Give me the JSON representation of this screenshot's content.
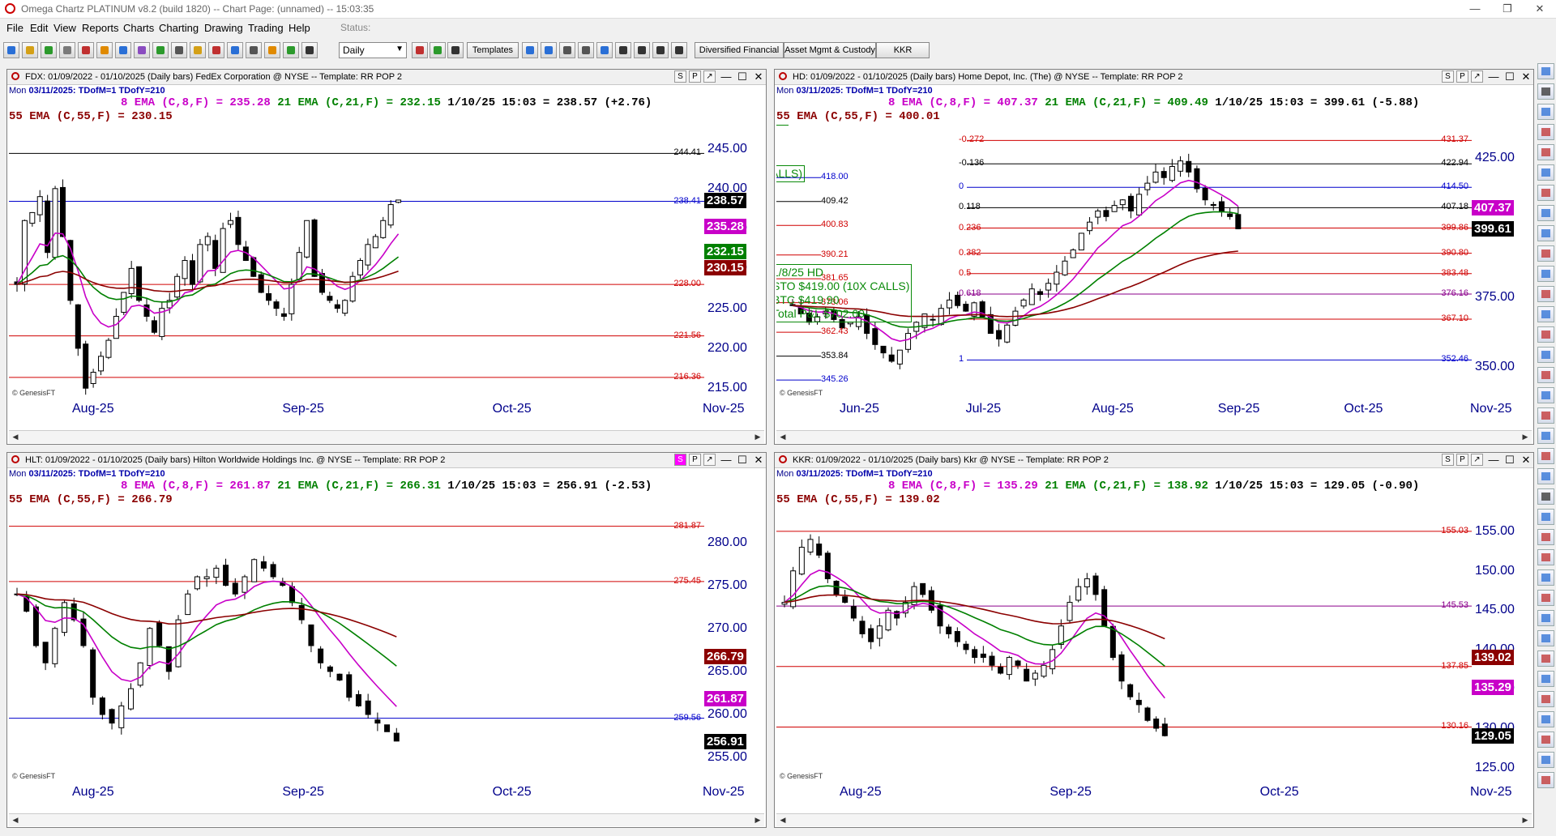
{
  "window": {
    "title": "Omega Chartz PLATINUM v8.2 (build 1820)  --  Chart Page: (unnamed)  --  15:03:35",
    "restore": "❐",
    "close": "✕"
  },
  "menu": [
    "File",
    "Edit",
    "View",
    "Reports",
    "Charts",
    "Charting",
    "Drawing",
    "Trading",
    "Help"
  ],
  "status_label": "Status:",
  "toolbar": {
    "period": "Daily",
    "templates_label": "Templates",
    "list_buttons": [
      "Diversified Financial",
      "Asset Mgmt & Custody",
      "KKR"
    ]
  },
  "colors": {
    "ema8": "#c800c8",
    "ema21": "#008000",
    "ema55": "#8b0000",
    "support": "#d00000",
    "blue_level": "#0000cc"
  },
  "panels": [
    {
      "id": "fdx",
      "title": "FDX: 01/09/2022 - 01/10/2025  (Daily bars)  FedEx Corporation @ NYSE  --  Template: RR POP 2",
      "date_line_day": "Mon",
      "date_line_date": "03/11/2025:",
      "date_line_rest": "TDofM=1  TDofY=210",
      "ema8": "8 EMA (C,8,F) = 235.28",
      "ema21": "21 EMA (C,21,F) = 232.15",
      "last": "1/10/25 15:03 = 238.57 (+2.76)",
      "ema55": "55 EMA (C,55,F) = 230.15",
      "s_active": false,
      "price_ticks": [
        "245.00",
        "240.00",
        "235.00",
        "230.00",
        "225.00",
        "220.00",
        "215.00"
      ],
      "price_boxes": [
        {
          "label": "238.57",
          "bg": "#000000",
          "fg": "#ffffff"
        },
        {
          "label": "235.28",
          "bg": "#c800c8",
          "fg": "#ffffff"
        },
        {
          "label": "232.15",
          "bg": "#008000",
          "fg": "#ffffff"
        },
        {
          "label": "230.15",
          "bg": "#8b0000",
          "fg": "#ffffff"
        }
      ],
      "levels": [
        {
          "label": "244.41",
          "color": "#000000"
        },
        {
          "label": "238.41",
          "color": "#0000cc"
        },
        {
          "label": "228.00",
          "color": "#d00000"
        },
        {
          "label": "221.56",
          "color": "#d00000"
        },
        {
          "label": "216.36",
          "color": "#d00000"
        }
      ],
      "x_ticks": [
        "Aug-25",
        "Sep-25",
        "Oct-25",
        "Nov-25"
      ],
      "watermark": "© GenesisFT",
      "chart_data": {
        "type": "candlestick",
        "price_range": [
          213.5,
          248
        ],
        "closes": [
          228,
          236,
          237,
          239,
          232,
          240,
          234,
          226,
          220,
          215,
          217,
          219,
          221,
          224,
          227,
          230,
          226,
          224,
          222,
          225,
          226,
          229,
          231,
          228,
          233,
          234,
          230,
          235,
          236,
          233,
          231,
          229,
          227,
          226,
          225,
          224,
          228,
          232,
          236,
          229,
          227,
          226,
          225,
          226,
          229,
          231,
          233,
          234,
          236,
          238,
          238.57
        ],
        "ema8_end": 235.28,
        "ema21_end": 232.15,
        "ema55_end": 230.15
      }
    },
    {
      "id": "hd",
      "title": "HD: 01/09/2022 - 01/10/2025  (Daily bars)  Home Depot, Inc. (The) @ NYSE  --  Template: RR POP 2",
      "date_line_day": "Mon",
      "date_line_date": "03/11/2025:",
      "date_line_rest": "TDofM=1  TDofY=210",
      "ema8": "8 EMA (C,8,F) = 407.37",
      "ema21": "21 EMA (C,21,F) = 409.49",
      "last": "1/10/25 15:03 = 399.61 (-5.88)",
      "ema55": "55 EMA (C,55,F) = 400.01",
      "s_active": false,
      "price_ticks": [
        "425.00",
        "375.00",
        "350.00"
      ],
      "price_boxes": [
        {
          "label": "407.37",
          "bg": "#c800c8",
          "fg": "#ffffff"
        },
        {
          "label": "399.61",
          "bg": "#000000",
          "fg": "#ffffff"
        }
      ],
      "fib_levels": [
        {
          "ratio": "-0.272",
          "label": "431.37",
          "color": "#d00000"
        },
        {
          "ratio": "-0.136",
          "label": "422.94",
          "color": "#000000"
        },
        {
          "ratio": "0",
          "label": "414.50",
          "color": "#0000cc"
        },
        {
          "ratio": "0.118",
          "label": "407.18",
          "color": "#000000"
        },
        {
          "ratio": "0.236",
          "label": "399.86",
          "color": "#d00000"
        },
        {
          "ratio": "0.382",
          "label": "390.80",
          "color": "#d00000"
        },
        {
          "ratio": "0.5",
          "label": "383.48",
          "color": "#d00000"
        },
        {
          "ratio": "0.618",
          "label": "376.16",
          "color": "#8b008b"
        },
        {
          "ratio": "",
          "label": "367.10",
          "color": "#d00000"
        },
        {
          "ratio": "1",
          "label": "352.46",
          "color": "#0000cc"
        }
      ],
      "left_levels": [
        {
          "label": "418.00",
          "color": "#0000cc"
        },
        {
          "label": "409.42",
          "color": "#000000"
        },
        {
          "label": "400.83",
          "color": "#d00000"
        },
        {
          "label": "390.21",
          "color": "#d00000"
        },
        {
          "label": "381.65",
          "color": "#d00000"
        },
        {
          "label": "373.06",
          "color": "#d00000"
        },
        {
          "label": "362.43",
          "color": "#d00000"
        },
        {
          "label": "353.84",
          "color": "#000000"
        },
        {
          "label": "345.26",
          "color": "#0000cc"
        }
      ],
      "note_lines": [
        "1/8/25 HD",
        "STO $419.00 (10X CALLS)",
        "BTC $419.90",
        "Total P&L $702.00"
      ],
      "note_fragments": [
        "CALLS)",
        "CALLS)",
        "LS)"
      ],
      "x_ticks": [
        "Jun-25",
        "Jul-25",
        "Aug-25",
        "Sep-25",
        "Oct-25",
        "Nov-25"
      ],
      "watermark": "© GenesisFT",
      "chart_data": {
        "type": "candlestick",
        "price_range": [
          338,
          437
        ],
        "closes": [
          372,
          369,
          366,
          368,
          370,
          367,
          364,
          366,
          368,
          362,
          358,
          355,
          352,
          356,
          362,
          366,
          369,
          367,
          371,
          374,
          372,
          370,
          373,
          368,
          362,
          360,
          365,
          370,
          374,
          378,
          376,
          380,
          384,
          388,
          392,
          398,
          402,
          406,
          404,
          408,
          410,
          406,
          412,
          416,
          420,
          418,
          422,
          424,
          420,
          414,
          410,
          408,
          406,
          404,
          399.61
        ],
        "ema8_end": 407.37,
        "ema21_end": 409.49,
        "ema55_end": 400.01
      }
    },
    {
      "id": "hlt",
      "title": "HLT: 01/09/2022 - 01/10/2025  (Daily bars)  Hilton Worldwide Holdings Inc. @ NYSE  --  Template: RR POP 2",
      "date_line_day": "Mon",
      "date_line_date": "03/11/2025:",
      "date_line_rest": "TDofM=1  TDofY=210",
      "ema8": "8 EMA (C,8,F) = 261.87",
      "ema21": "21 EMA (C,21,F) = 266.31",
      "last": "1/10/25 15:03 = 256.91 (-2.53)",
      "ema55": "55 EMA (C,55,F) = 266.79",
      "s_active": true,
      "price_ticks": [
        "280.00",
        "275.00",
        "270.00",
        "265.00",
        "260.00",
        "255.00"
      ],
      "price_boxes": [
        {
          "label": "266.79",
          "bg": "#8b0000",
          "fg": "#ffffff"
        },
        {
          "label": "261.87",
          "bg": "#c800c8",
          "fg": "#ffffff"
        },
        {
          "label": "256.91",
          "bg": "#000000",
          "fg": "#ffffff"
        }
      ],
      "levels": [
        {
          "label": "281.87",
          "color": "#d00000"
        },
        {
          "label": "275.45",
          "color": "#d00000"
        },
        {
          "label": "259.56",
          "color": "#0000cc"
        }
      ],
      "x_ticks": [
        "Aug-25",
        "Sep-25",
        "Oct-25",
        "Nov-25"
      ],
      "watermark": "© GenesisFT",
      "chart_data": {
        "type": "candlestick",
        "price_range": [
          252,
          284
        ],
        "closes": [
          274,
          272,
          268,
          266,
          270,
          273,
          271,
          268,
          262,
          260,
          259,
          261,
          263,
          266,
          270,
          268,
          265,
          271,
          274,
          276,
          276,
          277,
          275,
          274,
          276,
          278,
          277,
          276,
          275,
          273,
          271,
          268,
          266,
          265,
          264,
          262,
          261,
          260,
          259,
          258,
          256.91
        ],
        "ema8_end": 261.87,
        "ema21_end": 266.31,
        "ema55_end": 266.79
      }
    },
    {
      "id": "kkr",
      "title": "KKR: 01/09/2022 - 01/10/2025  (Daily bars)  Kkr @ NYSE  --  Template: RR POP 2",
      "date_line_day": "Mon",
      "date_line_date": "03/11/2025:",
      "date_line_rest": "TDofM=1  TDofY=210",
      "ema8": "8 EMA (C,8,F) = 135.29",
      "ema21": "21 EMA (C,21,F) = 138.92",
      "last": "1/10/25 15:03 = 129.05 (-0.90)",
      "ema55": "55 EMA (C,55,F) = 139.02",
      "s_active": false,
      "price_ticks": [
        "155.00",
        "150.00",
        "145.00",
        "140.00",
        "135.00",
        "130.00",
        "125.00"
      ],
      "price_boxes": [
        {
          "label": "139.02",
          "bg": "#8b0000",
          "fg": "#ffffff"
        },
        {
          "label": "135.29",
          "bg": "#c800c8",
          "fg": "#ffffff"
        },
        {
          "label": "129.05",
          "bg": "#000000",
          "fg": "#ffffff"
        }
      ],
      "levels": [
        {
          "label": "155.03",
          "color": "#d00000"
        },
        {
          "label": "145.53",
          "color": "#8b008b"
        },
        {
          "label": "137.85",
          "color": "#d00000"
        },
        {
          "label": "130.16",
          "color": "#d00000"
        }
      ],
      "x_ticks": [
        "Aug-25",
        "Sep-25",
        "Oct-25",
        "Nov-25"
      ],
      "watermark": "© GenesisFT",
      "chart_data": {
        "type": "candlestick",
        "price_range": [
          123,
          158
        ],
        "closes": [
          146,
          150,
          153,
          154,
          152,
          149,
          147,
          146,
          144,
          142,
          141,
          143,
          145,
          144,
          146,
          148,
          147,
          145,
          143,
          142,
          141,
          140,
          139,
          139,
          138,
          137,
          139,
          138,
          136,
          137,
          138,
          140,
          143,
          146,
          148,
          149,
          147,
          143,
          139,
          136,
          134,
          133,
          131,
          130,
          129.05
        ],
        "ema8_end": 135.29,
        "ema21_end": 138.92,
        "ema55_end": 139.02
      }
    }
  ]
}
